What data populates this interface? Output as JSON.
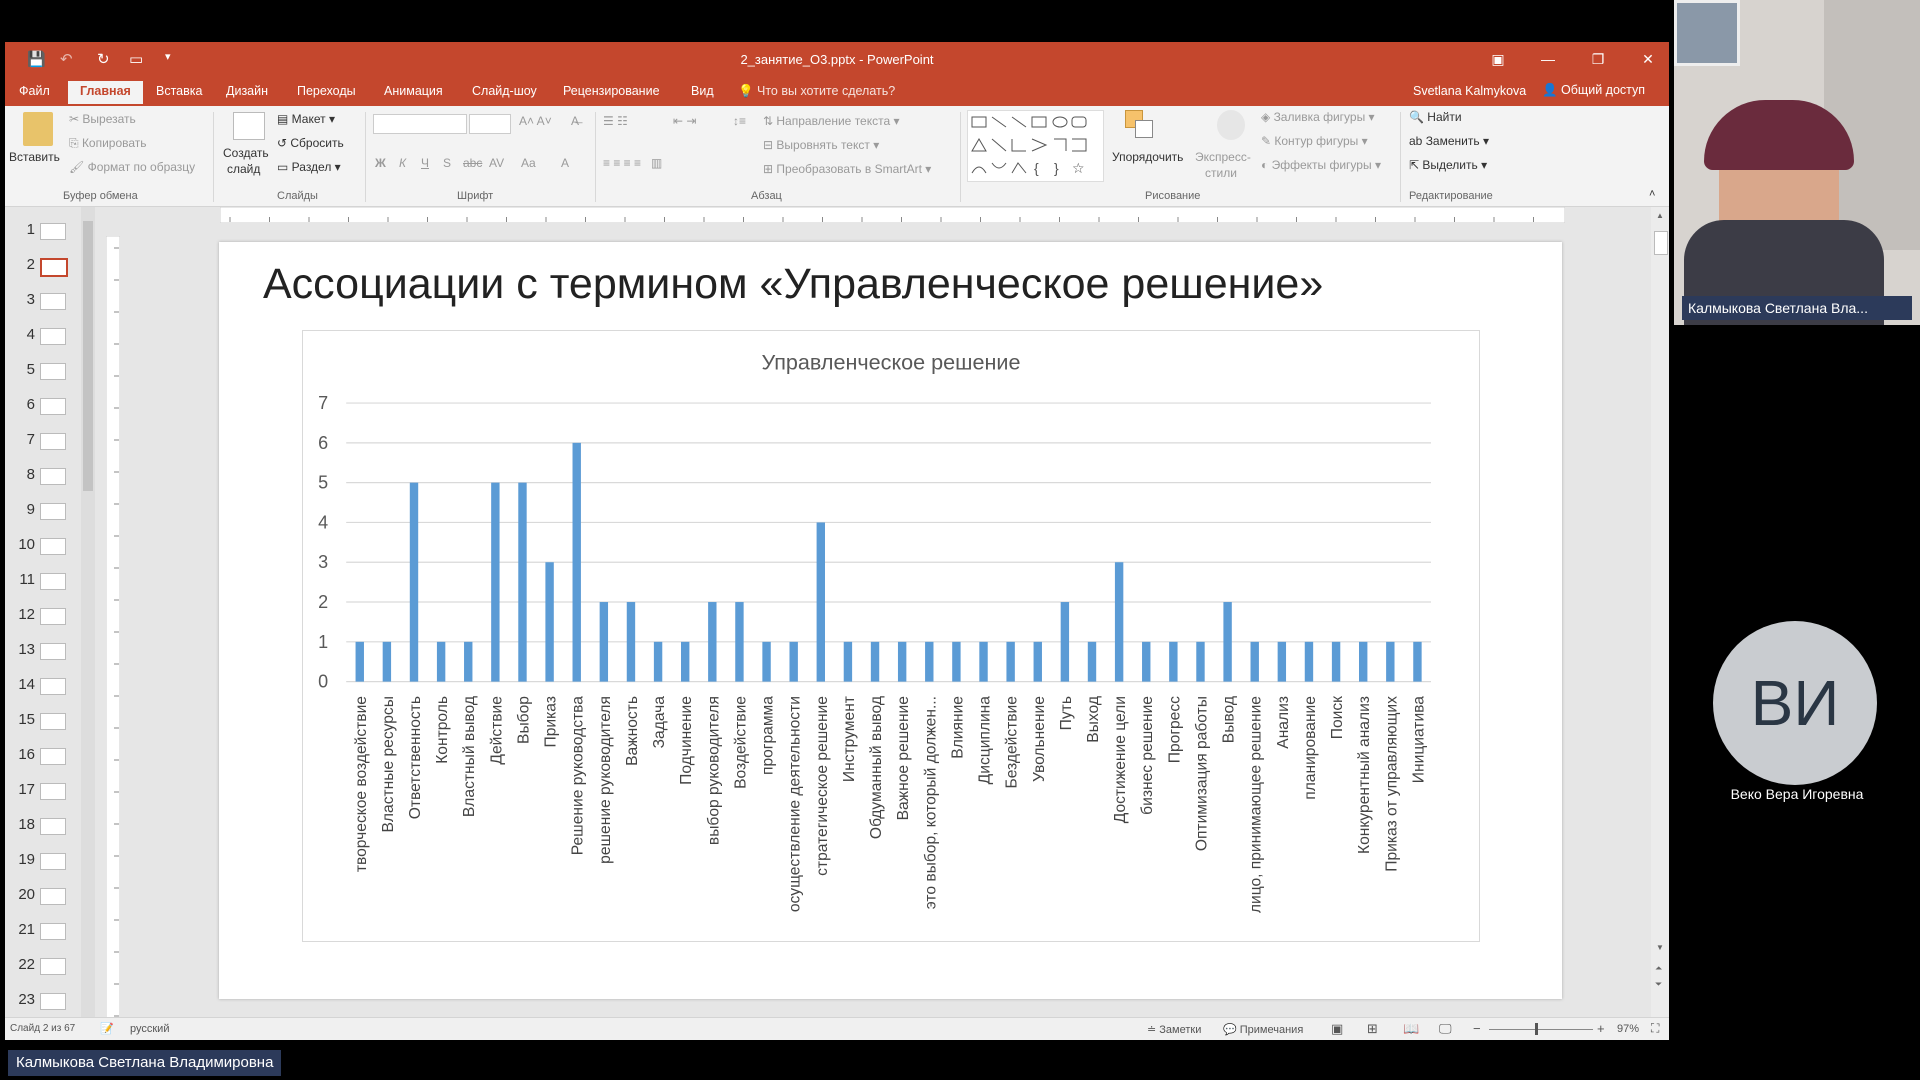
{
  "window": {
    "title": "2_занятие_О3.pptx - PowerPoint",
    "user": "Svetlana Kalmykova",
    "share": "Общий доступ"
  },
  "tabs": [
    "Файл",
    "Главная",
    "Вставка",
    "Дизайн",
    "Переходы",
    "Анимация",
    "Слайд-шоу",
    "Рецензирование",
    "Вид"
  ],
  "tell_me": "Что вы хотите сделать?",
  "ribbon": {
    "paste": "Вставить",
    "cut": "Вырезать",
    "copy": "Копировать",
    "format_painter": "Формат по образцу",
    "clipboard_group": "Буфер обмена",
    "new_slide_1": "Создать",
    "new_slide_2": "слайд",
    "layout": "Макет",
    "reset": "Сбросить",
    "section": "Раздел",
    "slides_group": "Слайды",
    "font_group": "Шрифт",
    "text_direction": "Направление текста",
    "align_text": "Выровнять текст",
    "smartart": "Преобразовать в SmartArt",
    "paragraph_group": "Абзац",
    "arrange": "Упорядочить",
    "quick_styles_1": "Экспресс-",
    "quick_styles_2": "стили",
    "shape_fill": "Заливка фигуры",
    "shape_outline": "Контур фигуры",
    "shape_effects": "Эффекты фигуры",
    "drawing_group": "Рисование",
    "find": "Найти",
    "replace": "Заменить",
    "select": "Выделить",
    "editing_group": "Редактирование"
  },
  "thumbnails": [
    "1",
    "2",
    "3",
    "4",
    "5",
    "6",
    "7",
    "8",
    "9",
    "10",
    "11",
    "12",
    "13",
    "14",
    "15",
    "16",
    "17",
    "18",
    "19",
    "20",
    "21",
    "22",
    "23"
  ],
  "selected_slide": 2,
  "slide": {
    "title": "Ассоциации с термином «Управленческое решение»"
  },
  "chart_data": {
    "type": "bar",
    "title": "Управленческое решение",
    "ylim": [
      0,
      7
    ],
    "yticks": [
      "0",
      "1",
      "2",
      "3",
      "4",
      "5",
      "6",
      "7"
    ],
    "grid": true,
    "legend": "none",
    "color": "#5b9bd5",
    "categories": [
      "творческое воздействие",
      "Властные ресурсы",
      "Ответственность",
      "Контроль",
      "Властный вывод",
      "Действие",
      "Выбор",
      "Приказ",
      "Решение руководства",
      "решение руководителя",
      "Важность",
      "Задача",
      "Подчинение",
      "выбор руководителя",
      "Воздействие",
      "программа",
      "осуществление деятельности",
      "стратегическое решение",
      "Инструмент",
      "Обдуманный вывод",
      "Важное решение",
      "это выбор, который должен...",
      "Влияние",
      "Дисциплина",
      "Бездействие",
      "Увольнение",
      "Путь",
      "Выход",
      "Достижение цели",
      "бизнес решение",
      "Прогресс",
      "Оптимизация работы",
      "Вывод",
      "лицо, принимающее решение",
      "Анализ",
      "планирование",
      "Поиск",
      "Конкурентный анализ",
      "Приказ от управляющих",
      "Инициатива"
    ],
    "values": [
      1,
      1,
      5,
      1,
      1,
      5,
      5,
      3,
      6,
      2,
      2,
      1,
      1,
      2,
      2,
      1,
      1,
      4,
      1,
      1,
      1,
      1,
      1,
      1,
      1,
      1,
      2,
      1,
      3,
      1,
      1,
      1,
      2,
      1,
      1,
      1,
      1,
      1,
      1,
      1
    ]
  },
  "status": {
    "slide_info": "Слайд 2 из 67",
    "language": "русский",
    "notes": "Заметки",
    "comments": "Примечания",
    "zoom": "97%"
  },
  "participants": {
    "presenter_short": "Калмыкова Светлана Вла...",
    "avatar_initials": "ВИ",
    "attendee": "Веко Вера Игоревна",
    "presenter_full": "Калмыкова Светлана Владимировна"
  }
}
